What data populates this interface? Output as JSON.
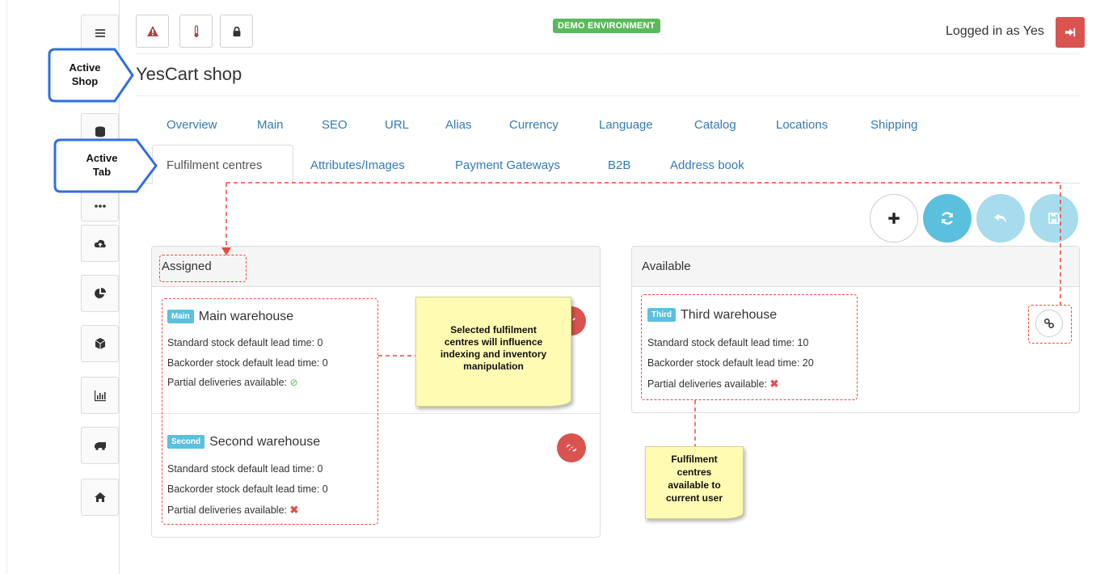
{
  "header": {
    "demo_badge": "DEMO ENVIRONMENT",
    "logged_in_text": "Logged in as Yes"
  },
  "page_title": "YesCart shop",
  "callouts": {
    "active_shop": [
      "Active",
      "Shop"
    ],
    "active_tab": [
      "Active",
      "Tab"
    ]
  },
  "tabs_row1": [
    "Overview",
    "Main",
    "SEO",
    "URL",
    "Alias",
    "Currency",
    "Language",
    "Catalog",
    "Locations",
    "Shipping"
  ],
  "tabs_row2": [
    "Fulfilment centres",
    "Attributes/Images",
    "Payment Gateways",
    "B2B",
    "Address book"
  ],
  "active_tab_index": 0,
  "assigned": {
    "title": "Assigned",
    "items": [
      {
        "badge": "Main",
        "name": "Main warehouse",
        "standard_lead": "Standard stock default lead time: 0",
        "backorder_lead": "Backorder stock default lead time: 0",
        "partial": "Partial deliveries available:",
        "partial_available": true
      },
      {
        "badge": "Second",
        "name": "Second warehouse",
        "standard_lead": "Standard stock default lead time: 0",
        "backorder_lead": "Backorder stock default lead time: 0",
        "partial": "Partial deliveries available:",
        "partial_available": false
      }
    ]
  },
  "available": {
    "title": "Available",
    "items": [
      {
        "badge": "Third",
        "name": "Third warehouse",
        "standard_lead": "Standard stock default lead time: 10",
        "backorder_lead": "Backorder stock default lead time: 20",
        "partial": "Partial deliveries available:",
        "partial_available": false
      }
    ]
  },
  "notes": {
    "selected": [
      "Selected fulfilment",
      "centres will influence",
      "indexing and inventory",
      "manipulation"
    ],
    "available": [
      "Fulfilment",
      "centres",
      "available to",
      "current user"
    ]
  },
  "colors": {
    "accent": "#337ab7",
    "info": "#5bc0de",
    "danger": "#d9534f",
    "success": "#5cb85c",
    "annotation": "#ee4a3a",
    "note_bg": "#fffbb2"
  },
  "icons": {
    "sidebar": [
      "menu-icon",
      "database-icon",
      "dots-icon",
      "cloud-upload-icon",
      "pie-chart-icon",
      "cube-icon",
      "bar-chart-icon",
      "truck-icon",
      "home-icon"
    ],
    "top": [
      "warning-icon",
      "thermometer-icon",
      "lock-icon"
    ],
    "actions": [
      "plus-icon",
      "refresh-icon",
      "undo-icon",
      "save-icon"
    ]
  }
}
